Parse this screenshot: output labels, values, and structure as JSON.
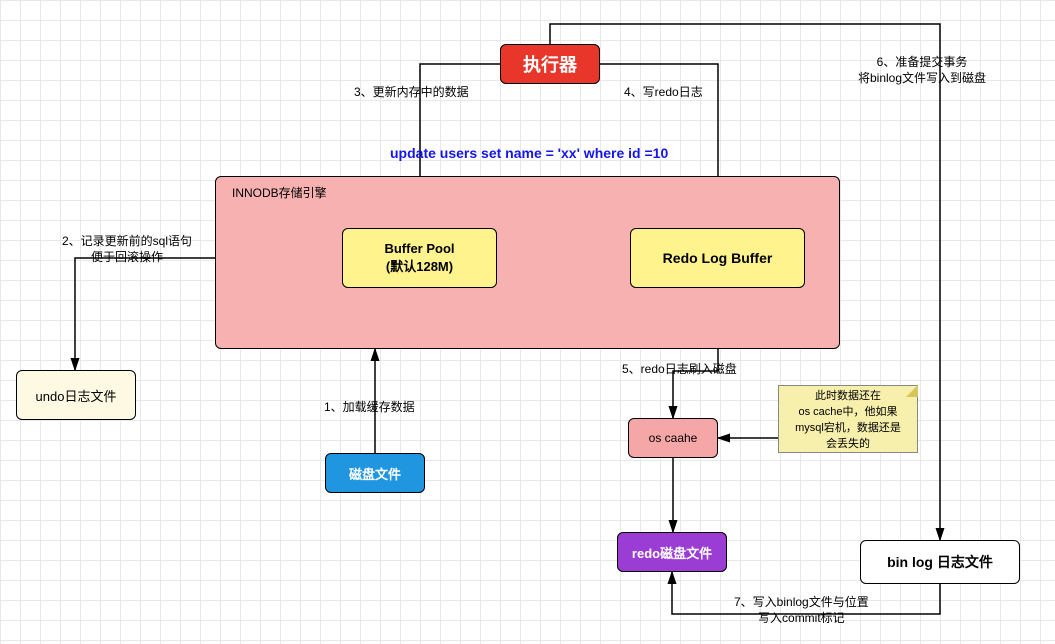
{
  "executor": "执行器",
  "innodb_label": "INNODB存储引擎",
  "buffer_pool": "Buffer Pool\n(默认128M)",
  "redo_buffer": "Redo Log Buffer",
  "undo_file": "undo日志文件",
  "disk_file": "磁盘文件",
  "os_cache": "os caahe",
  "redo_disk": "redo磁盘文件",
  "binlog_file": "bin log 日志文件",
  "note": "此时数据还在\nos cache中，他如果\nmysql宕机，数据还是\n会丢失的",
  "sql": "update users set name = 'xx' where id =10",
  "labels": {
    "l1": "1、加载缓存数据",
    "l2": "2、记录更新前的sql语句\n便于回滚操作",
    "l3": "3、更新内存中的数据",
    "l4": "4、写redo日志",
    "l5": "5、redo日志刷入磁盘",
    "l6": "6、准备提交事务\n将binlog文件写入到磁盘",
    "l7": "7、写入binlog文件与位置\n写入commit标记"
  }
}
